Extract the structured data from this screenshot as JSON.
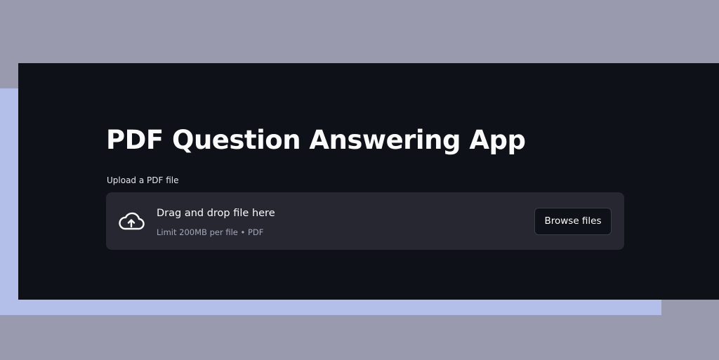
{
  "app": {
    "title": "PDF Question Answering App"
  },
  "uploader": {
    "label": "Upload a PDF file",
    "dropzone_title": "Drag and drop file here",
    "dropzone_hint": "Limit 200MB per file • PDF",
    "icon": "cloud-upload-icon",
    "browse_label": "Browse files"
  },
  "colors": {
    "outer_background": "#9a9aae",
    "accent_band": "#b3bfe8",
    "app_background": "#0e1117",
    "dropzone_background": "#262730",
    "text_primary": "#fafafa",
    "text_secondary": "#a3a8b8"
  }
}
